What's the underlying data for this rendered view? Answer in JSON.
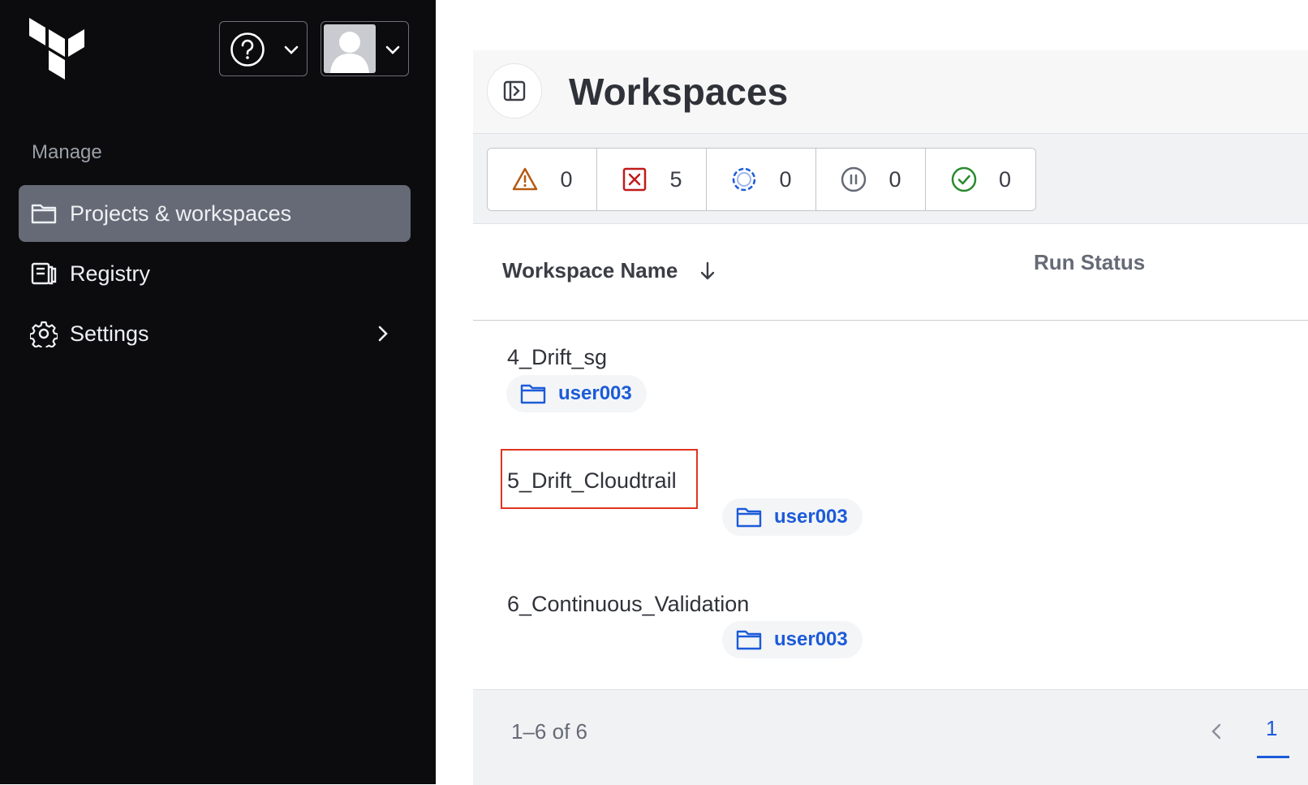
{
  "sidebar": {
    "heading": "Manage",
    "items": [
      {
        "label": "Projects & workspaces",
        "icon": "folder-icon",
        "active": true
      },
      {
        "label": "Registry",
        "icon": "registry-icon"
      },
      {
        "label": "Settings",
        "icon": "gear-icon"
      }
    ]
  },
  "header": {
    "title": "Workspaces"
  },
  "status_filters": [
    {
      "icon": "warning-icon",
      "count": "0",
      "color": "#b55a12"
    },
    {
      "icon": "error-icon",
      "count": "5",
      "color": "#c01b1b"
    },
    {
      "icon": "running-icon",
      "count": "0",
      "color": "#1c5bd9"
    },
    {
      "icon": "paused-icon",
      "count": "0",
      "color": "#656a76"
    },
    {
      "icon": "success-icon",
      "count": "0",
      "color": "#2a8a2f"
    }
  ],
  "table": {
    "columns": {
      "name": "Workspace Name",
      "status": "Run Status"
    },
    "rows": [
      {
        "name": "4_Drift_sg",
        "project": "user003"
      },
      {
        "name": "5_Drift_Cloudtrail",
        "project": "user003"
      },
      {
        "name": "6_Continuous_Validation",
        "project": "user003"
      }
    ]
  },
  "pagination": {
    "count": "1–6 of 6",
    "current_page": "1"
  },
  "colors": {
    "sidebar_bg": "#0c0c0e",
    "active_nav": "#656a76",
    "link_blue": "#1c5bd9",
    "highlight_red": "#e0341f"
  }
}
